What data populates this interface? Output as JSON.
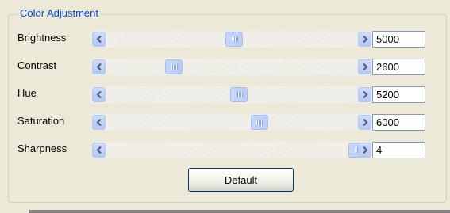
{
  "group": {
    "title": "Color Adjustment"
  },
  "sliders": [
    {
      "label": "Brightness",
      "value": "5000",
      "position": 0.51
    },
    {
      "label": "Contrast",
      "value": "2600",
      "position": 0.27
    },
    {
      "label": "Hue",
      "value": "5200",
      "position": 0.53
    },
    {
      "label": "Saturation",
      "value": "6000",
      "position": 0.61
    },
    {
      "label": "Sharpness",
      "value": "4",
      "position": 1.0
    }
  ],
  "default_button": {
    "label": "Default"
  },
  "colors": {
    "group_title": "#0046d5",
    "window_bg": "#ece9d8",
    "scroll_button": "#c1d3fb",
    "textbox_border": "#7f9db9"
  },
  "icons": {
    "scroll_left": "chevron-left-icon",
    "scroll_right": "chevron-right-icon",
    "thumb_grip": "grip-icon"
  }
}
